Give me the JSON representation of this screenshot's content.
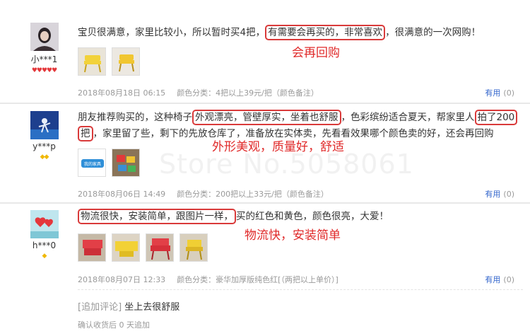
{
  "reviews": [
    {
      "username": "小***1",
      "text_a": "宝贝很满意，家里比较小，所以暂时买4把，",
      "text_hl": "有需要会再买的，非常喜欢",
      "text_b": "，很满意的一次网购！",
      "annotation": "会再回购",
      "date": "2018年08月18日 06:15",
      "variant": "颜色分类：4把以上39元/把（颜色备注）",
      "useful_label": "有用",
      "useful_count": "(0)"
    },
    {
      "username": "y***p",
      "text_1": "朋友推荐购买的，这种椅子",
      "text_hl1": "外观漂亮，管壁厚实，坐着也舒服",
      "text_2": "，色彩缤纷适合夏天，帮家里人",
      "text_hl2a": "拍了200",
      "text_hl2b": "把",
      "text_3": "，家里留了些，剩下的先放仓库了，准备放在实体卖，先看看效果哪个颜色卖的好，还会再回购",
      "annotation": "外形美观，质量好，舒适",
      "date": "2018年08月06日 14:49",
      "variant": "颜色分类：200把以上33元/把（颜色备注）",
      "useful_label": "有用",
      "useful_count": "(0)"
    },
    {
      "username": "h***0",
      "text_hl": "物流很快，安装简单，跟图片一样，",
      "text_b": "买的红色和黄色，颜色很亮，大爱！",
      "annotation": "物流快，安装简单",
      "date": "2018年08月07日 12:33",
      "variant": "颜色分类：豪华加厚版纯色红[（两把以上单价）]",
      "useful_label": "有用",
      "useful_count": "(0)",
      "followup_tag": "[追加评论]",
      "followup_text": "坐上去很舒服",
      "followup_note": "确认收货后 0 天追加"
    }
  ],
  "watermark": "Store No.5058061",
  "thumb_logo": "我的家具",
  "colors": {
    "highlight": "#d93a3a",
    "annotation": "#e02a2a",
    "link": "#3366cc",
    "meta": "#999999"
  }
}
